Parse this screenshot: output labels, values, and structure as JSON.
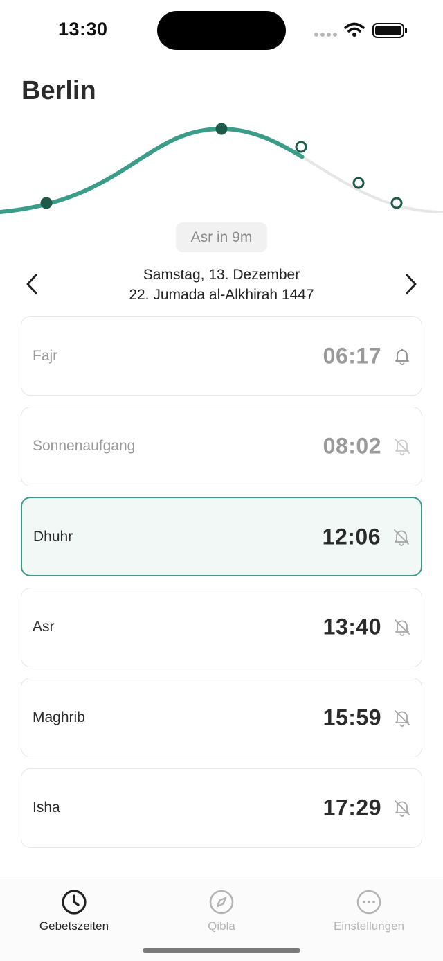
{
  "status_bar": {
    "time": "13:30"
  },
  "header": {
    "city": "Berlin"
  },
  "sun_curve": {
    "progress_fraction": 0.68,
    "accent_color": "#3a9d8a",
    "dot_color": "#1e5a4a"
  },
  "next_prayer": {
    "label": "Asr in 9m"
  },
  "date": {
    "gregorian": "Samstag, 13. Dezember",
    "hijri": "22. Jumada al-Alkhirah 1447"
  },
  "prayers": [
    {
      "name": "Fajr",
      "time": "06:17",
      "notify": true,
      "state": "past"
    },
    {
      "name": "Sonnenaufgang",
      "time": "08:02",
      "notify": false,
      "state": "past"
    },
    {
      "name": "Dhuhr",
      "time": "12:06",
      "notify": false,
      "state": "current"
    },
    {
      "name": "Asr",
      "time": "13:40",
      "notify": false,
      "state": "upcoming"
    },
    {
      "name": "Maghrib",
      "time": "15:59",
      "notify": false,
      "state": "upcoming"
    },
    {
      "name": "Isha",
      "time": "17:29",
      "notify": false,
      "state": "upcoming"
    }
  ],
  "tabs": [
    {
      "label": "Gebetszeiten",
      "icon": "clock-icon",
      "active": true
    },
    {
      "label": "Qibla",
      "icon": "compass-icon",
      "active": false
    },
    {
      "label": "Einstellungen",
      "icon": "more-icon",
      "active": false
    }
  ]
}
